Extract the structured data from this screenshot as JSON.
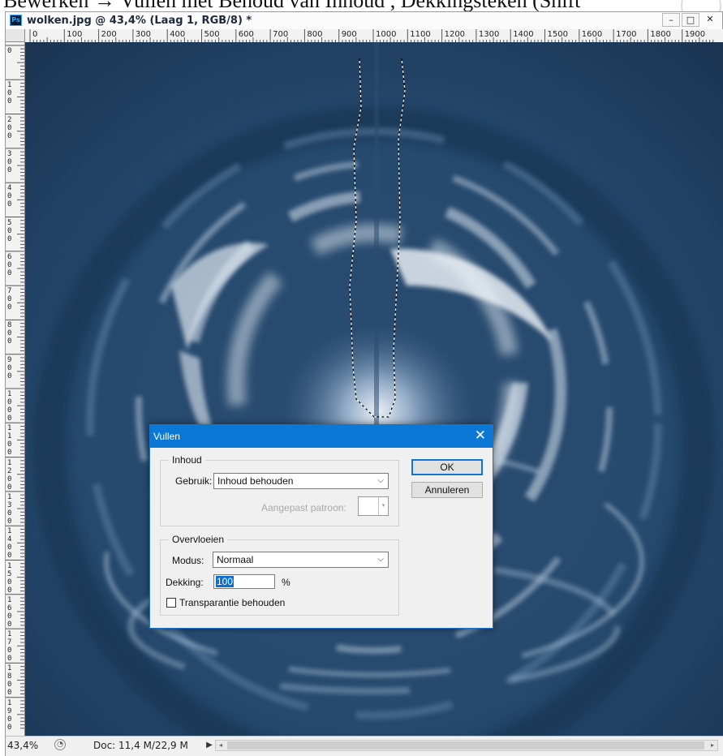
{
  "caption": {
    "text": "Bewerken → Vullen met Behoud van Inhoud , Dekkingsteken (Shift"
  },
  "window": {
    "app_badge": "Ps",
    "title": "wolken.jpg @ 43,4% (Laag 1, RGB/8) *",
    "minimize_label": "–",
    "maximize_label": "□",
    "close_label": "✕"
  },
  "ruler_top": {
    "labels": [
      "0",
      "100",
      "200",
      "300",
      "400",
      "500",
      "600",
      "700",
      "800",
      "900",
      "1000",
      "1100",
      "1200",
      "1300",
      "1400",
      "1500",
      "1600",
      "1700",
      "1800",
      "1900"
    ]
  },
  "ruler_left": {
    "labels": [
      "0",
      "100",
      "200",
      "300",
      "400",
      "500",
      "600",
      "700",
      "800",
      "900",
      "1000",
      "1100",
      "1200",
      "1300",
      "1400",
      "1500",
      "1600",
      "1700",
      "1800",
      "1900"
    ]
  },
  "status": {
    "zoom": "43,4%",
    "doc_info": "Doc: 11,4 M/22,9 M",
    "arrow": "▶"
  },
  "dialog": {
    "title": "Vullen",
    "close_label": "✕",
    "group_content": "Inhoud",
    "use_label": "Gebruik:",
    "use_value": "Inhoud behouden",
    "pattern_label": "Aangepast patroon:",
    "group_blend": "Overvloeien",
    "mode_label": "Modus:",
    "mode_value": "Normaal",
    "opacity_label": "Dekking:",
    "opacity_value": "100",
    "opacity_unit": "%",
    "preserve_label": "Transparantie behouden",
    "ok_label": "OK",
    "cancel_label": "Annuleren"
  },
  "colors": {
    "dialog_title_bg": "#0a78d4",
    "canvas_dark": "#1f3d5c",
    "sky_light": "#dfe8f2"
  },
  "icons": [
    "ps-app-icon",
    "minimize-icon",
    "maximize-icon",
    "close-icon",
    "status-info-icon",
    "status-arrow-icon",
    "chevron-down-icon",
    "dialog-close-icon"
  ]
}
